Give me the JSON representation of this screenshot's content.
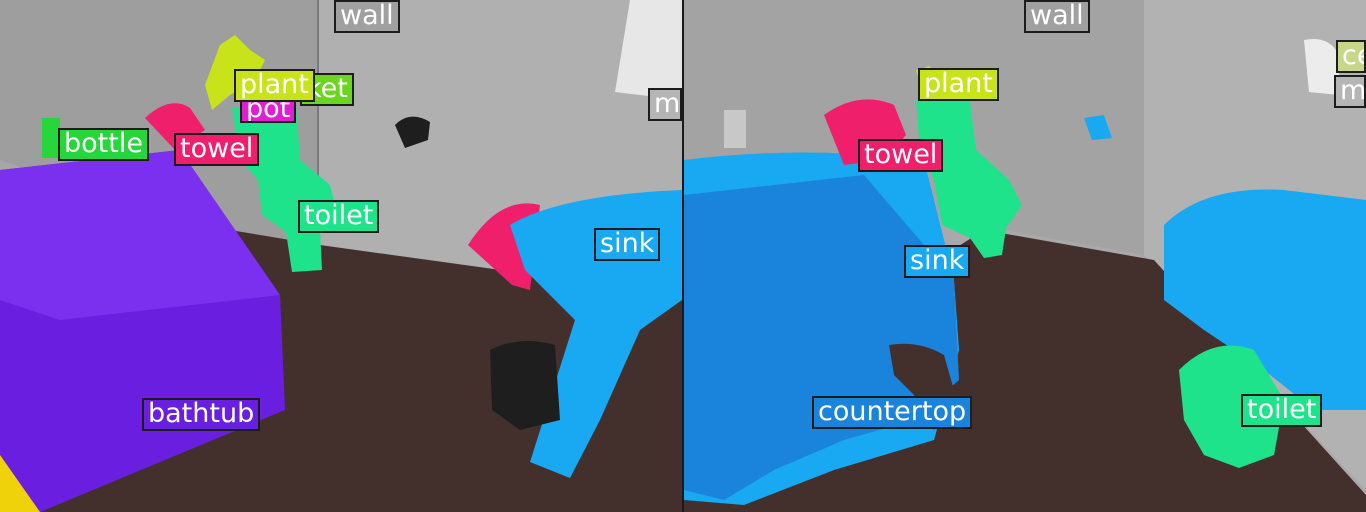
{
  "panels": [
    {
      "labels": [
        {
          "id": "wall",
          "text": "wall"
        },
        {
          "id": "basket",
          "text": "ket"
        },
        {
          "id": "pot",
          "text": "pot"
        },
        {
          "id": "plant",
          "text": "plant"
        },
        {
          "id": "bottle",
          "text": "bottle"
        },
        {
          "id": "towel",
          "text": "towel"
        },
        {
          "id": "toilet",
          "text": "toilet"
        },
        {
          "id": "sink",
          "text": "sink"
        },
        {
          "id": "bathtub",
          "text": "bathtub"
        },
        {
          "id": "mirror",
          "text": "m"
        }
      ]
    },
    {
      "labels": [
        {
          "id": "wall",
          "text": "wall"
        },
        {
          "id": "plant",
          "text": "plant"
        },
        {
          "id": "towel",
          "text": "towel"
        },
        {
          "id": "sink",
          "text": "sink"
        },
        {
          "id": "countertop",
          "text": "countertop"
        },
        {
          "id": "toilet",
          "text": "toilet"
        },
        {
          "id": "ceiling",
          "text": "ce"
        },
        {
          "id": "mirror",
          "text": "m"
        }
      ]
    }
  ],
  "colors": {
    "wall": "#a9a9a9",
    "floor": "#43302d",
    "bathtub": "#6a1fe0",
    "toilet": "#1fe38a",
    "sink": "#19a8f2",
    "towel": "#ef1f6c",
    "bottle": "#27d63a",
    "plant": "#c9e31b",
    "pot": "#e01fd3",
    "basket": "#6ad61d",
    "countertop": "#1a84dc",
    "dark": "#1e1e1e"
  }
}
